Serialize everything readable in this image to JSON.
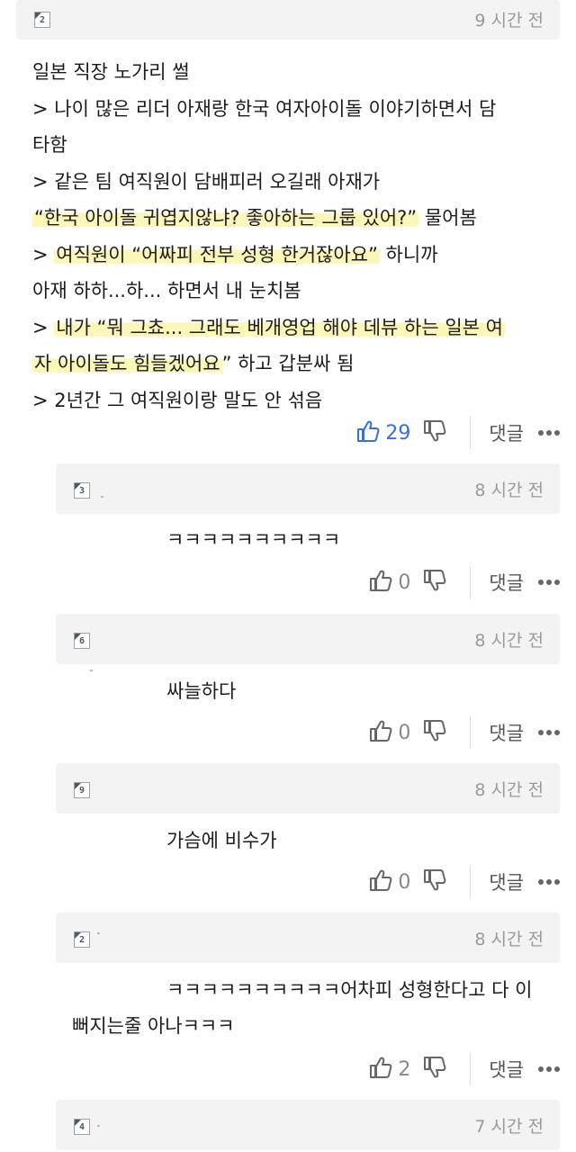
{
  "post": {
    "level": "2",
    "time": "9 시간 전",
    "lines": [
      "일본 직장 노가리 썰",
      "> 나이 많은 리더 아재랑 한국 여자아이돌 이야기하면서 담",
      "타함",
      "> 같은 팀 여직원이 담배피러 오길래 아재가",
      "“한국 아이돌 귀엽지않냐? 좋아하는 그룹 있어?”",
      " 물어봄",
      "> ",
      "여직원이 “어짜피 전부 성형 한거잖아요”",
      " 하니까",
      "아재 하하...하... 하면서 내 눈치봄",
      "> ",
      "내가 “뭐 그쵸... 그래도 베개영업 해야 데뷰 하는 일본 여",
      "자 아이돌도 힘들겠어요",
      "” 하고 갑분싸 됨",
      "> 2년간 그 여직원이랑 말도 안 섞음"
    ],
    "likes": "29",
    "reply_label": "댓글",
    "accent": "#3a6fd8"
  },
  "replies": [
    {
      "level": "3",
      "time": "8 시간 전",
      "text": "ㅋㅋㅋㅋㅋㅋㅋㅋㅋㅋ",
      "likes": "0",
      "reply_label": "댓글"
    },
    {
      "level": "6",
      "time": "8 시간 전",
      "text": "싸늘하다",
      "likes": "0",
      "reply_label": "댓글"
    },
    {
      "level": "9",
      "time": "8 시간 전",
      "text": "가슴에 비수가",
      "likes": "0",
      "reply_label": "댓글"
    },
    {
      "level": "2",
      "time": "8 시간 전",
      "text_line1": "ㅋㅋㅋㅋㅋㅋㅋㅋㅋㅋ어차피 성형한다고 다 이",
      "text_line2": "뻐지는줄 아나ㅋㅋㅋ",
      "likes": "2",
      "reply_label": "댓글"
    },
    {
      "level": "4",
      "time": "7 시간 전"
    }
  ]
}
